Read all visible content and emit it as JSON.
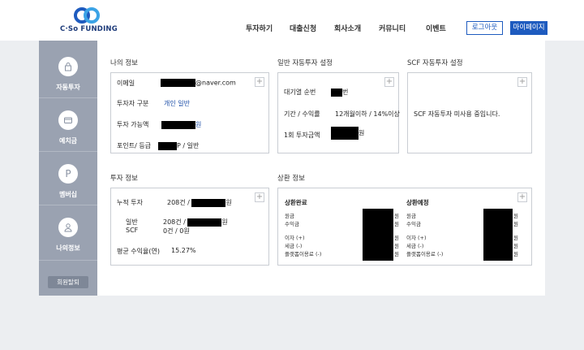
{
  "header": {
    "logo_text": "C·So FUNDING",
    "nav": [
      "투자하기",
      "대출신청",
      "회사소개",
      "커뮤니티",
      "이벤트"
    ],
    "login_label": "로그아웃",
    "mypage_label": "마이페이지"
  },
  "sidebar": {
    "items": [
      {
        "label": "자동투자",
        "icon": "lock-icon"
      },
      {
        "label": "예치금",
        "icon": "card-icon"
      },
      {
        "label": "멤버십",
        "icon": "p-icon"
      },
      {
        "label": "나의정보",
        "icon": "user-icon"
      }
    ],
    "withdraw_label": "회원탈퇴"
  },
  "my_info": {
    "title": "나의 정보",
    "email_label": "이메일",
    "email_value": "@naver.com",
    "investor_type_label": "투자자 구분",
    "investor_type_value": "개인 일반",
    "available_label": "투자 가능액",
    "available_unit": "원",
    "points_label": "포인트/ 등급",
    "points_value": "P / 일반"
  },
  "auto_invest": {
    "title": "일반 자동투자 설정",
    "queue_label": "대기열 순번",
    "queue_unit": "번",
    "period_label": "기간 / 수익률",
    "period_value": "12개월이하 / 14%이상",
    "single_label": "1회 투자금액",
    "single_unit": "원"
  },
  "scf_auto": {
    "title": "SCF 자동투자 설정",
    "message": "SCF 자동투자 미사용 중입니다."
  },
  "invest_info": {
    "title": "투자 정보",
    "total_label": "누적 투자",
    "total_count": "208건 /",
    "won": "원",
    "general_label": "일반",
    "general_count": "208건 /",
    "scf_label": "SCF",
    "scf_value": "0건 / 0원",
    "avg_label": "평균 수익율(연)",
    "avg_value": "15.27%"
  },
  "repay_info": {
    "title": "상환 정보",
    "done_title": "상환완료",
    "plan_title": "상환예정",
    "labels": [
      "원금",
      "수익금",
      "이자 (+)",
      "세금 (-)",
      "플랫폼이용료 (-)"
    ],
    "won": "원"
  }
}
